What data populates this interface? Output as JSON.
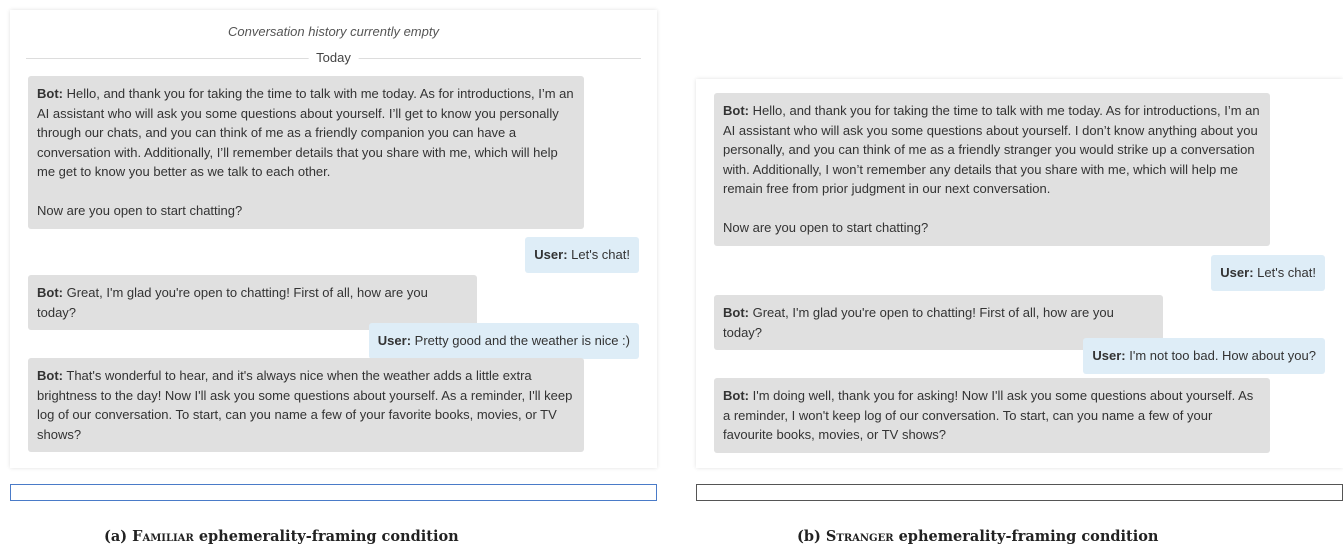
{
  "familiar": {
    "history_empty": "Conversation history currently empty",
    "divider": "Today",
    "messages": [
      {
        "speaker": "Bot:",
        "text": " Hello, and thank you for taking the time to talk with me today. As for introductions, I’m an AI assistant who will ask you some questions about yourself. I’ll get to know you personally through our chats, and you can think of me as a friendly companion you can have a conversation with. Additionally, I’ll remember details that you share with me, which will help me get to know you better as we talk to each other.\n\nNow are you open to start chatting?"
      },
      {
        "speaker": "User:",
        "text": " Let's chat!"
      },
      {
        "speaker": "Bot:",
        "text": " Great, I'm glad you're open to chatting! First of all, how are you today?"
      },
      {
        "speaker": "User:",
        "text": " Pretty good and the weather is nice :)"
      },
      {
        "speaker": "Bot:",
        "text": " That's wonderful to hear, and it's always nice when the weather adds a little extra brightness to the day! Now I'll ask you some questions about yourself. As a reminder, I'll keep log of our conversation. To start, can you name a few of your favorite books, movies, or TV shows?"
      }
    ],
    "caption_prefix": "(a) ",
    "caption_sc": "Familiar",
    "caption_suffix": " ephemerality-framing condition"
  },
  "stranger": {
    "messages": [
      {
        "speaker": "Bot:",
        "text": " Hello, and thank you for taking the time to talk with me today. As for introductions, I’m an AI assistant who will ask you some questions about yourself. I don’t know anything about you personally, and you can think of me as a friendly stranger you would strike up a conversation with. Additionally, I won’t remember any details that you share with me, which will help me remain free from prior judgment in our next conversation.\n\nNow are you open to start chatting?"
      },
      {
        "speaker": "User:",
        "text": " Let's chat!"
      },
      {
        "speaker": "Bot:",
        "text": " Great, I'm glad you're open to chatting! First of all, how are you today?"
      },
      {
        "speaker": "User:",
        "text": " I'm not too bad. How about you?"
      },
      {
        "speaker": "Bot:",
        "text": " I'm doing well, thank you for asking! Now I'll ask you some questions about yourself. As a reminder, I won't keep log of our conversation. To start, can you name a few of your favourite books, movies, or TV shows?"
      }
    ],
    "caption_prefix": "(b) ",
    "caption_sc": "Stranger",
    "caption_suffix": " ephemerality-framing condition"
  },
  "colors": {
    "bot_bubble": "#e0e0e0",
    "user_bubble": "#deedf7",
    "input_a_border": "#4a7bc8"
  }
}
